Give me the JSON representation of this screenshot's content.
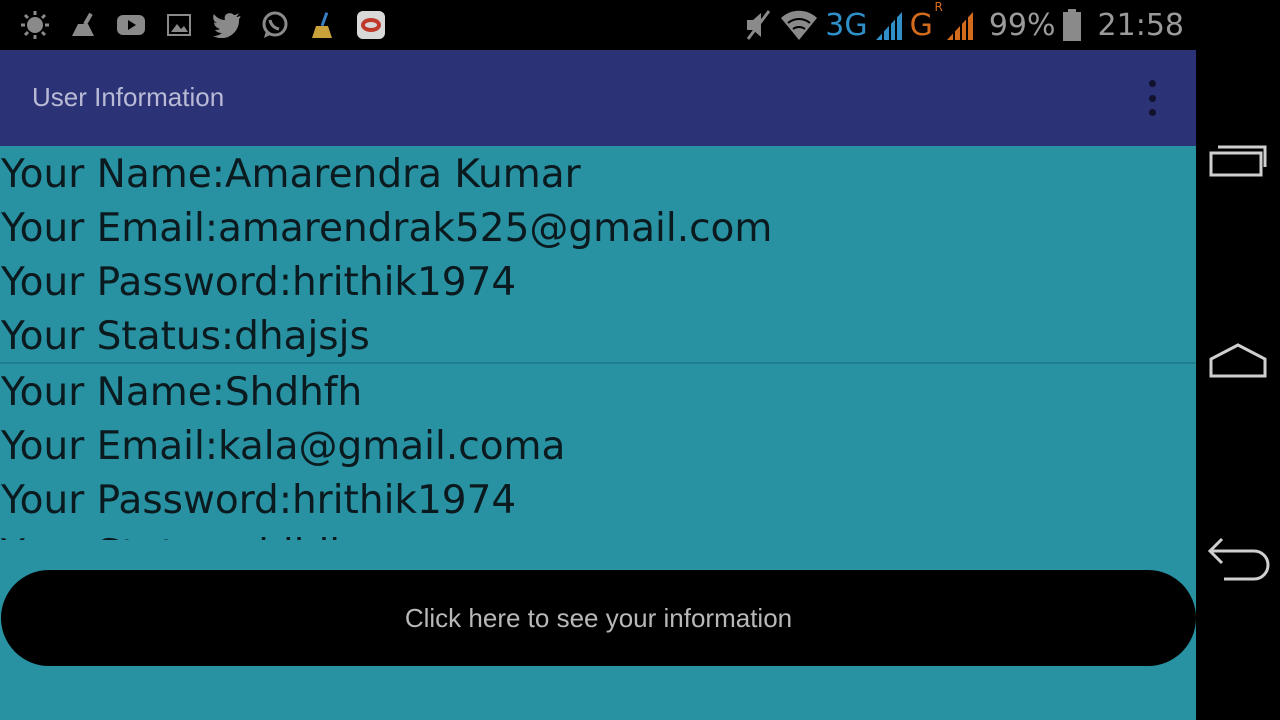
{
  "status_bar": {
    "left_icons": [
      "brightness-icon",
      "cleaner-icon",
      "youtube-icon",
      "gallery-icon",
      "twitter-icon",
      "whatsapp-icon",
      "broom-icon",
      "app-icon"
    ],
    "right": {
      "mute": "vibrate-off-icon",
      "wifi": "wifi-icon",
      "network_3g": "3G",
      "network_g": "G",
      "roaming": "R",
      "battery_percent": "99%",
      "time": "21:58"
    }
  },
  "app_bar": {
    "title": "User Information",
    "menu_icon": "overflow-menu-icon"
  },
  "records": [
    {
      "name_label": "Your Name:",
      "name": "Amarendra Kumar",
      "email_label": "Your Email:",
      "email": "amarendrak525@gmail.com",
      "password_label": "Your Password:",
      "password": "hrithik1974",
      "status_label": "Your Status:",
      "status": "dhajsjs"
    },
    {
      "name_label": "Your Name:",
      "name": "Shdhfh",
      "email_label": "Your Email:",
      "email": "kala@gmail.coma",
      "password_label": "Your Password:",
      "password": "hrithik1974",
      "status_label": "Your Status:",
      "status": "ejdjdj"
    }
  ],
  "button": {
    "label": "Click here to see your information"
  },
  "colors": {
    "status_bar": "#000000",
    "app_bar": "#2b3275",
    "content_bg": "#2892a3",
    "button_bg": "#000000",
    "text": "#0b1a1e"
  }
}
